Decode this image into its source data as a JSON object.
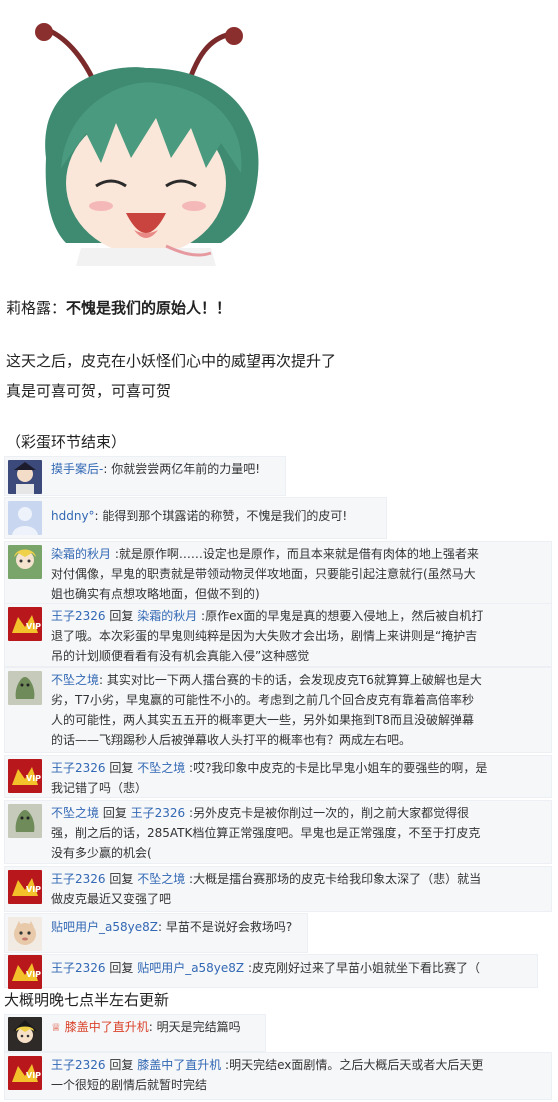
{
  "story": {
    "speaker": "莉格露：",
    "speech": "不愧是我们的原始人！！",
    "line1": "这天之后，皮克在小妖怪们心中的威望再次提升了",
    "line2": "真是可喜可贺，可喜可贺",
    "end_note": "（彩蛋环节结束）",
    "update_note": "大概明晚七点半左右更新"
  },
  "comments": [
    {
      "user": "摸手案后-",
      "sep": ": ",
      "text": "你就尝尝两亿年前的力量吧!"
    },
    {
      "user": "hddny°",
      "sep": ": ",
      "text": "能得到那个琪露诺的称赞，不愧是我们的皮可!"
    },
    {
      "user": "染霜的秋月",
      "sep": " :",
      "lines": [
        "就是原作啊……设定也是原作，而且本来就是借有肉体的地上强者来",
        "对付偶像，早鬼的职责就是带领动物灵伴攻地面，只要能引起注意就行(虽然马大",
        "姐也确实有点想攻略地面，但做不到的)"
      ]
    },
    {
      "user": "王子2326",
      "reply": " 回复 ",
      "target": "染霜的秋月",
      "sep": " :",
      "lines": [
        "原作ex面的早鬼是真的想要入侵地上，然后被自机打",
        "退了哦。本次彩蛋的早鬼则纯粹是因为大失败才会出场，剧情上来讲则是“掩护吉",
        "吊的计划顺便看看有没有机会真能入侵”这种感觉"
      ]
    },
    {
      "user": "不坠之境",
      "sep": ": ",
      "lines": [
        "其实对比一下两人擂台赛的卡的话，会发现皮克T6就算算上破解也是大",
        "劣，T7小劣，早鬼赢的可能性不小的。考虑到之前几个回合皮克有靠着高倍率秒",
        "人的可能性，两人其实五五开的概率更大一些，另外如果拖到T8而且没破解弹幕",
        "的话——飞翔踢秒人后被弹幕收人头打平的概率也有？两成左右吧。"
      ]
    },
    {
      "user": "王子2326",
      "reply": " 回复 ",
      "target": "不坠之境",
      "sep": " :",
      "lines": [
        "哎?我印象中皮克的卡是比早鬼小姐车的要强些的啊，是",
        "我记错了吗（悲）"
      ]
    },
    {
      "user": "不坠之境",
      "reply": " 回复 ",
      "target": "王子2326",
      "sep": " :",
      "lines": [
        "另外皮克卡是被你削过一次的，削之前大家都觉得很",
        "强，削之后的话，285ATK档位算正常强度吧。早鬼也是正常强度，不至于打皮克",
        "没有多少赢的机会("
      ]
    },
    {
      "user": "王子2326",
      "reply": " 回复 ",
      "target": "不坠之境",
      "sep": " :",
      "lines": [
        "大概是擂台赛那场的皮克卡给我印象太深了（悲）就当",
        "做皮克最近又变强了吧"
      ]
    },
    {
      "user": "贴吧用户_a58ye8Z",
      "sep": ": ",
      "text": "早苗不是说好会救场吗?"
    },
    {
      "user": "王子2326",
      "reply": " 回复 ",
      "target": "贴吧用户_a58ye8Z",
      "sep": " :",
      "text": "皮克刚好过来了早苗小姐就坐下看比赛了（"
    },
    {
      "badge": "♕",
      "user": "膝盖中了直升机",
      "sep": ": ",
      "text": "明天是完结篇吗"
    },
    {
      "user": "王子2326",
      "reply": " 回复 ",
      "target": "膝盖中了直升机",
      "sep": " :",
      "lines": [
        "明天完结ex面剧情。之后大概后天或者大后天更",
        "一个很短的剧情后就暂时完结"
      ]
    }
  ],
  "colors": {
    "link": "#3268b4",
    "text": "#333333",
    "comment_bg": "#f6f7f9"
  }
}
